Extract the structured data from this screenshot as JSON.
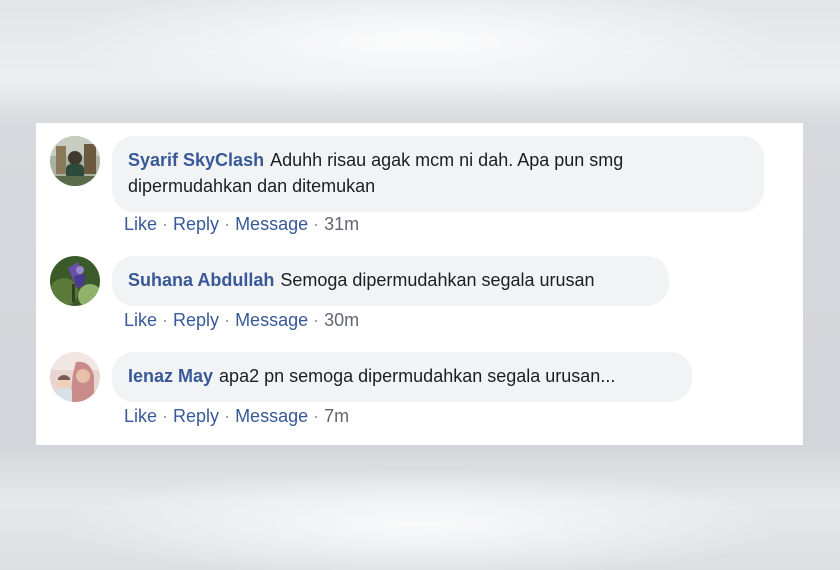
{
  "comments": [
    {
      "author": "Syarif SkyClash",
      "text_line1": "Aduhh risau agak mcm ni dah. Apa pun smg",
      "text_line2": "dipermudahkan dan ditemukan",
      "actions": {
        "like": "Like",
        "reply": "Reply",
        "message": "Message",
        "sep": "·",
        "time": "31m"
      },
      "avatar_colors": [
        "#5a6b4a",
        "#a8b2a0",
        "#2e3a2a"
      ]
    },
    {
      "author": "Suhana Abdullah",
      "text": "Semoga dipermudahkan segala urusan",
      "actions": {
        "like": "Like",
        "reply": "Reply",
        "message": "Message",
        "sep": "·",
        "time": "30m"
      },
      "avatar_colors": [
        "#3b5a2a",
        "#6a4fa8",
        "#8fb36a"
      ]
    },
    {
      "author": "Ienaz May",
      "text": "apa2 pn semoga dipermudahkan segala urusan...",
      "actions": {
        "like": "Like",
        "reply": "Reply",
        "message": "Message",
        "sep": "·",
        "time": "7m"
      },
      "avatar_colors": [
        "#e8d4d0",
        "#c98a8a",
        "#7a5a55"
      ]
    }
  ]
}
